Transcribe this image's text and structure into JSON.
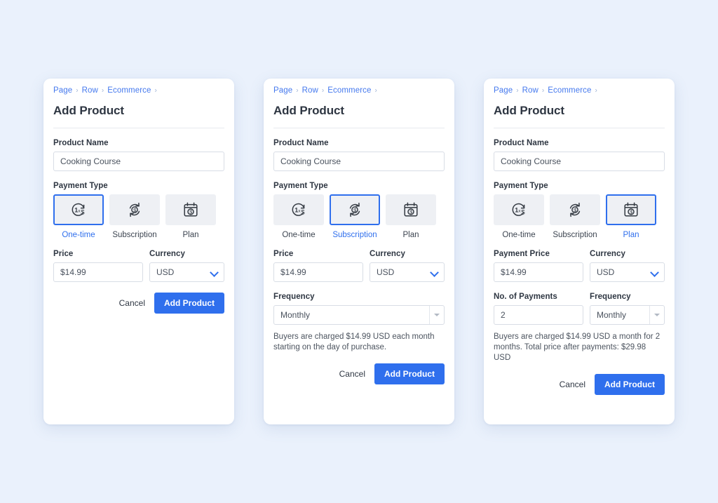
{
  "theme": {
    "page_background": "#eaf1fc",
    "card_background": "#ffffff",
    "accent": "#2f6fed",
    "link": "#4579ee",
    "text": "#2e3642",
    "muted_text": "#4c545f",
    "tile_background": "#eef0f4",
    "input_border": "#d8dde5"
  },
  "breadcrumb": {
    "items": [
      "Page",
      "Row",
      "Ecommerce"
    ],
    "separator": "›"
  },
  "title": "Add Product",
  "labels": {
    "product_name": "Product Name",
    "payment_type": "Payment Type",
    "price": "Price",
    "payment_price": "Payment Price",
    "currency": "Currency",
    "frequency": "Frequency",
    "no_of_payments": "No. of Payments"
  },
  "payment_types": [
    {
      "id": "one-time",
      "label": "One-time",
      "icon": "one-time-dollar-icon"
    },
    {
      "id": "subscription",
      "label": "Subscription",
      "icon": "recurring-dollar-icon"
    },
    {
      "id": "plan",
      "label": "Plan",
      "icon": "calendar-dollar-icon"
    }
  ],
  "actions": {
    "cancel": "Cancel",
    "submit": "Add Product"
  },
  "cards": [
    {
      "id": "card-one-time",
      "selected_payment_type": "one-time",
      "product_name_value": "Cooking Course",
      "price_label": "Price",
      "price_value": "$14.99",
      "currency_value": "USD",
      "has_frequency": false,
      "has_payments_count": false,
      "helper_text": ""
    },
    {
      "id": "card-subscription",
      "selected_payment_type": "subscription",
      "product_name_value": "Cooking Course",
      "price_label": "Price",
      "price_value": "$14.99",
      "currency_value": "USD",
      "has_frequency": true,
      "has_payments_count": false,
      "frequency_value": "Monthly",
      "helper_text": "Buyers are charged $14.99 USD each month starting on the day of purchase."
    },
    {
      "id": "card-plan",
      "selected_payment_type": "plan",
      "product_name_value": "Cooking Course",
      "price_label": "Payment Price",
      "price_value": "$14.99",
      "currency_value": "USD",
      "has_frequency": true,
      "has_payments_count": true,
      "payments_count_value": "2",
      "frequency_value": "Monthly",
      "helper_text": "Buyers are charged $14.99 USD a month for 2 months. Total price after payments: $29.98 USD"
    }
  ]
}
